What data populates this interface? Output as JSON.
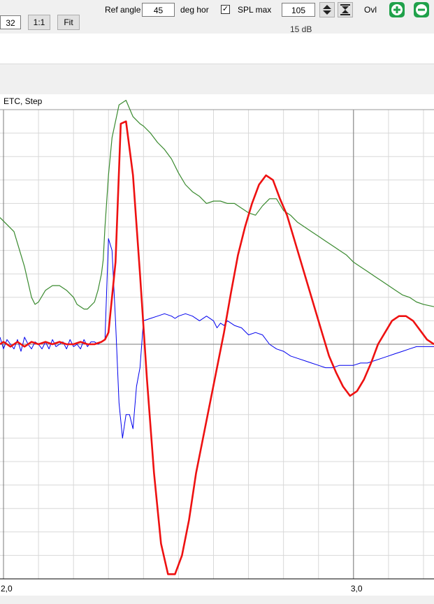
{
  "toolbar": {
    "zoom_value": "32",
    "one_to_one_label": "1:1",
    "fit_label": "Fit",
    "ref_angle_label": "Ref angle",
    "ref_angle_value": "45",
    "deg_hor_label": "deg hor",
    "spl_max_label": "SPL max",
    "spl_max_checked": true,
    "spl_max_value": "105",
    "ovl_label": "Ovl",
    "behind_text": "15 dB"
  },
  "chart_data": {
    "type": "line",
    "title": "ETC, Step",
    "x_tick_labels": [
      "2,0",
      "3,0"
    ],
    "x_ticks": [
      2.0,
      3.0
    ],
    "xlim": [
      1.99,
      3.23
    ],
    "ylim": [
      -1.0,
      1.0
    ],
    "grid": true,
    "series": [
      {
        "color": "#3a8a2f",
        "x": [
          1.99,
          2.03,
          2.06,
          2.08,
          2.09,
          2.1,
          2.12,
          2.14,
          2.16,
          2.18,
          2.2,
          2.21,
          2.23,
          2.24,
          2.26,
          2.27,
          2.28,
          2.285,
          2.29,
          2.3,
          2.31,
          2.33,
          2.35,
          2.37,
          2.39,
          2.4,
          2.42,
          2.44,
          2.46,
          2.48,
          2.5,
          2.52,
          2.54,
          2.56,
          2.58,
          2.6,
          2.62,
          2.64,
          2.66,
          2.68,
          2.7,
          2.72,
          2.74,
          2.76,
          2.78,
          2.8,
          2.82,
          2.84,
          2.86,
          2.88,
          2.9,
          2.92,
          2.94,
          2.96,
          2.98,
          3.0,
          3.02,
          3.04,
          3.06,
          3.08,
          3.1,
          3.12,
          3.14,
          3.16,
          3.18,
          3.2,
          3.23
        ],
        "values": [
          0.54,
          0.48,
          0.33,
          0.2,
          0.17,
          0.18,
          0.23,
          0.25,
          0.25,
          0.23,
          0.2,
          0.17,
          0.15,
          0.15,
          0.18,
          0.23,
          0.3,
          0.36,
          0.5,
          0.72,
          0.88,
          1.02,
          1.04,
          0.97,
          0.94,
          0.93,
          0.9,
          0.86,
          0.83,
          0.79,
          0.73,
          0.68,
          0.65,
          0.63,
          0.6,
          0.61,
          0.61,
          0.6,
          0.6,
          0.58,
          0.56,
          0.55,
          0.59,
          0.62,
          0.62,
          0.57,
          0.55,
          0.52,
          0.5,
          0.48,
          0.46,
          0.44,
          0.42,
          0.4,
          0.38,
          0.35,
          0.33,
          0.31,
          0.29,
          0.27,
          0.25,
          0.23,
          0.21,
          0.2,
          0.18,
          0.17,
          0.16
        ]
      },
      {
        "color": "#0000ee",
        "x": [
          1.99,
          2.0,
          2.01,
          2.02,
          2.03,
          2.04,
          2.05,
          2.06,
          2.07,
          2.08,
          2.09,
          2.1,
          2.11,
          2.12,
          2.13,
          2.14,
          2.15,
          2.16,
          2.17,
          2.18,
          2.19,
          2.2,
          2.21,
          2.22,
          2.23,
          2.24,
          2.25,
          2.26,
          2.27,
          2.28,
          2.29,
          2.3,
          2.31,
          2.32,
          2.33,
          2.34,
          2.35,
          2.36,
          2.37,
          2.38,
          2.39,
          2.4,
          2.42,
          2.44,
          2.46,
          2.48,
          2.49,
          2.5,
          2.52,
          2.54,
          2.56,
          2.58,
          2.6,
          2.61,
          2.62,
          2.63,
          2.64,
          2.66,
          2.68,
          2.7,
          2.72,
          2.74,
          2.76,
          2.78,
          2.8,
          2.82,
          2.84,
          2.86,
          2.88,
          2.9,
          2.92,
          2.94,
          2.96,
          2.98,
          3.0,
          3.02,
          3.04,
          3.06,
          3.08,
          3.1,
          3.12,
          3.14,
          3.16,
          3.18,
          3.2,
          3.23
        ],
        "values": [
          0.03,
          -0.02,
          0.02,
          0.0,
          -0.02,
          0.02,
          -0.03,
          0.03,
          0.0,
          -0.02,
          0.01,
          0.0,
          -0.02,
          0.01,
          -0.02,
          0.02,
          -0.01,
          0.0,
          0.01,
          -0.02,
          0.02,
          -0.01,
          0.0,
          -0.02,
          0.02,
          -0.01,
          0.01,
          0.01,
          0.0,
          0.01,
          0.02,
          0.45,
          0.4,
          0.1,
          -0.25,
          -0.4,
          -0.3,
          -0.3,
          -0.36,
          -0.18,
          -0.1,
          0.1,
          0.11,
          0.12,
          0.13,
          0.12,
          0.11,
          0.12,
          0.13,
          0.12,
          0.1,
          0.12,
          0.1,
          0.07,
          0.09,
          0.08,
          0.1,
          0.08,
          0.07,
          0.04,
          0.05,
          0.04,
          0.0,
          -0.02,
          -0.03,
          -0.05,
          -0.06,
          -0.07,
          -0.08,
          -0.09,
          -0.1,
          -0.1,
          -0.09,
          -0.09,
          -0.09,
          -0.08,
          -0.08,
          -0.07,
          -0.06,
          -0.05,
          -0.04,
          -0.03,
          -0.02,
          -0.01,
          -0.01,
          -0.01
        ]
      },
      {
        "color": "#ee1111",
        "x": [
          1.99,
          2.0,
          2.02,
          2.04,
          2.06,
          2.08,
          2.1,
          2.12,
          2.14,
          2.16,
          2.18,
          2.2,
          2.22,
          2.24,
          2.26,
          2.28,
          2.29,
          2.3,
          2.32,
          2.335,
          2.35,
          2.37,
          2.39,
          2.41,
          2.43,
          2.45,
          2.47,
          2.49,
          2.51,
          2.53,
          2.55,
          2.57,
          2.59,
          2.61,
          2.63,
          2.65,
          2.67,
          2.69,
          2.71,
          2.73,
          2.75,
          2.77,
          2.79,
          2.81,
          2.83,
          2.85,
          2.87,
          2.89,
          2.91,
          2.93,
          2.95,
          2.97,
          2.99,
          3.01,
          3.03,
          3.05,
          3.07,
          3.09,
          3.11,
          3.13,
          3.15,
          3.17,
          3.19,
          3.21,
          3.23
        ],
        "values": [
          0.0,
          0.01,
          -0.01,
          0.01,
          -0.01,
          0.01,
          0.0,
          0.01,
          0.0,
          0.01,
          0.0,
          0.0,
          0.01,
          0.0,
          0.0,
          0.01,
          0.02,
          0.05,
          0.35,
          0.94,
          0.95,
          0.72,
          0.3,
          -0.15,
          -0.55,
          -0.85,
          -0.98,
          -0.98,
          -0.9,
          -0.75,
          -0.55,
          -0.4,
          -0.25,
          -0.1,
          0.05,
          0.22,
          0.38,
          0.5,
          0.6,
          0.68,
          0.72,
          0.7,
          0.62,
          0.55,
          0.45,
          0.35,
          0.25,
          0.15,
          0.05,
          -0.05,
          -0.12,
          -0.18,
          -0.22,
          -0.2,
          -0.15,
          -0.08,
          0.0,
          0.05,
          0.1,
          0.12,
          0.12,
          0.1,
          0.06,
          0.02,
          0.0
        ]
      }
    ]
  }
}
